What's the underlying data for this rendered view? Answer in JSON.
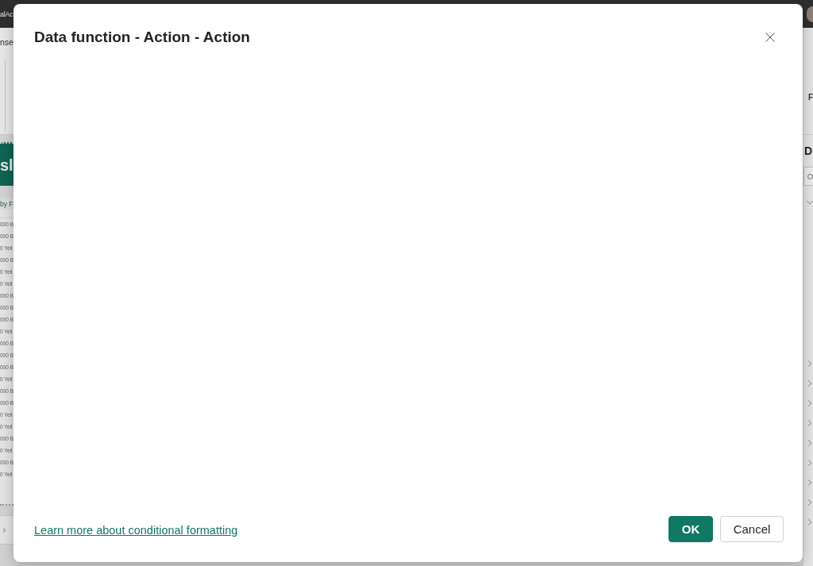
{
  "background_app": {
    "title_bar": {
      "title": "alAc"
    },
    "ribbon": {
      "tab": "nse"
    },
    "report": {
      "banner_title": "sl",
      "table": {
        "header": "by F",
        "rows": [
          "000 B",
          "000 B",
          "0 Yell",
          "000 B",
          "0 Yell",
          "0 Yell",
          "000 B",
          "000 B",
          "000 B",
          "0 Yell",
          "000 B",
          "000 B",
          "000 B",
          "0 Yell",
          "000 B",
          "000 B",
          "0 Yell",
          "0 Yell",
          "000 B",
          "0 Yell",
          "000 B",
          "0 Yell"
        ]
      }
    },
    "right_pane": {
      "header_label": "F",
      "title": "D",
      "fields": [
        {
          "expanded": true
        },
        {
          "expanded": false
        },
        {
          "expanded": false
        },
        {
          "expanded": false
        },
        {
          "expanded": false
        },
        {
          "expanded": false
        },
        {
          "expanded": false
        },
        {
          "expanded": false
        },
        {
          "expanded": false
        },
        {
          "expanded": false
        }
      ]
    }
  },
  "dialog": {
    "title": "Data function - Action - Action",
    "link": "Learn more about conditional formatting",
    "buttons": [
      {
        "label": "OK",
        "kind": "primary"
      },
      {
        "label": "Cancel",
        "kind": "secondary"
      }
    ]
  }
}
